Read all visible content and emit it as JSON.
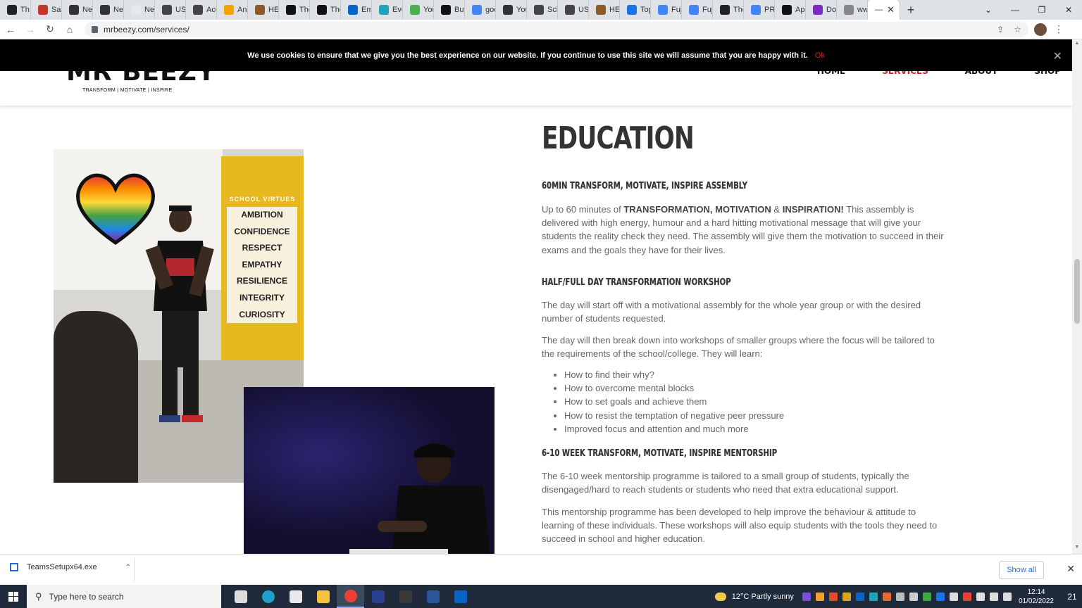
{
  "browser": {
    "tabs": [
      {
        "label": "Th",
        "color": "#222222"
      },
      {
        "label": "Sal",
        "color": "#c0392b"
      },
      {
        "label": "Ne",
        "color": "#333333"
      },
      {
        "label": "Ne",
        "color": "#333333"
      },
      {
        "label": "Ne",
        "color": "#e8e8e8"
      },
      {
        "label": "US",
        "color": "#444444"
      },
      {
        "label": "Acc",
        "color": "#444444"
      },
      {
        "label": "An",
        "color": "#f4a300"
      },
      {
        "label": "HE",
        "color": "#8b5a2b"
      },
      {
        "label": "The",
        "color": "#111111"
      },
      {
        "label": "The",
        "color": "#111111"
      },
      {
        "label": "Em",
        "color": "#0a64c8"
      },
      {
        "label": "Eve",
        "color": "#1fa4b8"
      },
      {
        "label": "You",
        "color": "#4caf50"
      },
      {
        "label": "Buy",
        "color": "#111111"
      },
      {
        "label": "goo",
        "color": "#4285f4"
      },
      {
        "label": "You",
        "color": "#333333"
      },
      {
        "label": "Sch",
        "color": "#444444"
      },
      {
        "label": "US",
        "color": "#444444"
      },
      {
        "label": "HE",
        "color": "#8b5a2b"
      },
      {
        "label": "Top",
        "color": "#1a73e8"
      },
      {
        "label": "Fuj",
        "color": "#4285f4"
      },
      {
        "label": "Fuj",
        "color": "#4285f4"
      },
      {
        "label": "The",
        "color": "#222222"
      },
      {
        "label": "PR",
        "color": "#4285f4"
      },
      {
        "label": "Ap",
        "color": "#111111"
      },
      {
        "label": "Do",
        "color": "#7b2cbf"
      },
      {
        "label": "ww",
        "color": "#888888"
      }
    ],
    "active_tab_label": "—",
    "url": "mrbeezy.com/services/"
  },
  "cookie": {
    "message": "We use cookies to ensure that we give you the best experience on our website. If you continue to use this site we will assume that you are happy with it.",
    "ok_label": "Ok",
    "close_label": "✕"
  },
  "site": {
    "logo_text": "MR BEEZY",
    "tagline": "TRANSFORM | MOTIVATE | INSPIRE",
    "nav": [
      "HOME",
      "SERVICES",
      "ABOUT",
      "SHOP"
    ],
    "active_nav": "SERVICES"
  },
  "photo1": {
    "banner_head": "SCHOOL VIRTUES",
    "virtues": [
      "AMBITION",
      "CONFIDENCE",
      "RESPECT",
      "EMPATHY",
      "RESILIENCE",
      "INTEGRITY",
      "CURIOSITY"
    ]
  },
  "content": {
    "title": "EDUCATION",
    "section1": {
      "heading": "60MIN TRANSFORM, MOTIVATE, INSPIRE ASSEMBLY",
      "intro": "Up to 60 minutes of ",
      "bold1": "TRANSFORMATION",
      "comma": ", ",
      "bold2": "MOTIVATION",
      "amp": " & ",
      "bold3": "INSPIRATION!",
      "rest": " This assembly is delivered with high energy, humour and a hard hitting motivational message that will give your students the reality check they need. The assembly will give them the motivation to succeed in their exams and the goals they have for their lives."
    },
    "section2": {
      "heading": "HALF/FULL DAY TRANSFORMATION WORKSHOP",
      "p1": "The day will start off with a motivational assembly for the whole year group or with the desired number of students requested.",
      "p2": "The day will then break down into workshops of smaller groups where the focus will be tailored to the requirements of the school/college. They will learn:",
      "bullets": [
        "How to find their why?",
        "How to overcome mental blocks",
        "How to set goals and achieve them",
        "How to resist the temptation of negative peer pressure",
        "Improved focus and attention and much more"
      ]
    },
    "section3": {
      "heading": "6-10 WEEK TRANSFORM, MOTIVATE, INSPIRE MENTORSHIP",
      "p1": "The 6-10 week mentorship programme is tailored to a small group of students, typically the disengaged/hard to reach students or students who need that extra educational support.",
      "p2": "This mentorship programme has been developed to help improve the behaviour & attitude to learning of these individuals. These workshops will also equip students with the tools they need to succeed in school and higher education."
    }
  },
  "downloads": {
    "file": "TeamsSetupx64.exe",
    "show_all": "Show all"
  },
  "taskbar": {
    "search_placeholder": "Type here to search",
    "apps": [
      {
        "name": "task-view",
        "color": "#dddddd"
      },
      {
        "name": "edge",
        "color": "#1fa0c8"
      },
      {
        "name": "store",
        "color": "#e9e9e9"
      },
      {
        "name": "explorer",
        "color": "#f5c242"
      },
      {
        "name": "chrome",
        "color": "#e94235"
      },
      {
        "name": "sims",
        "color": "#2c3e8f"
      },
      {
        "name": "sims2",
        "color": "#3a3a3a"
      },
      {
        "name": "word",
        "color": "#2b579a"
      },
      {
        "name": "outlook",
        "color": "#0a64c8"
      }
    ],
    "weather": "12°C  Partly sunny",
    "time": "12:14",
    "date": "01/02/2022",
    "notifications": "21"
  }
}
